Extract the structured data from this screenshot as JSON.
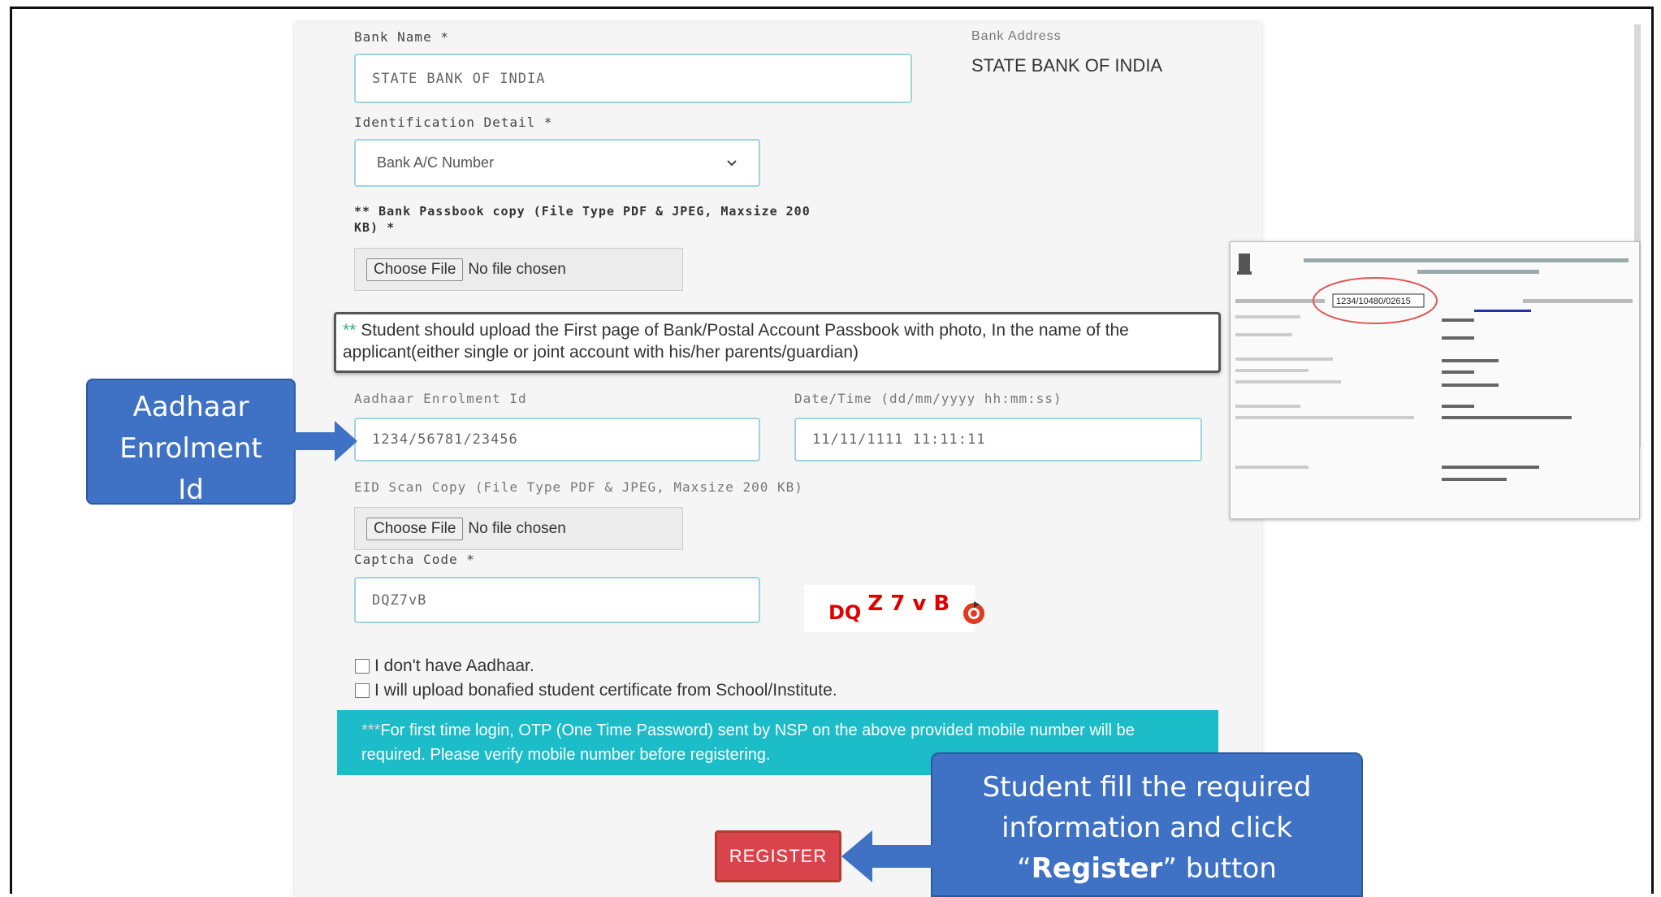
{
  "form": {
    "bank_name_label": "Bank Name *",
    "bank_name_value": "STATE BANK OF INDIA",
    "bank_address_label": "Bank Address",
    "bank_address_value": "STATE BANK OF INDIA",
    "identification_label": "Identification Detail *",
    "identification_value": "Bank A/C Number",
    "passbook_label": "** Bank Passbook copy (File Type PDF & JPEG, Maxsize 200 KB) *",
    "choose_file": "Choose File",
    "no_file": "No file chosen",
    "note_star": "**",
    "note_text": " Student should upload the First page of Bank/Postal Account Passbook with photo, In the name of the applicant(either single or joint account with his/her parents/guardian)",
    "aadhaar_label": "Aadhaar Enrolment Id",
    "aadhaar_value": "1234/56781/23456",
    "datetime_label": "Date/Time (dd/mm/yyyy hh:mm:ss)",
    "datetime_value": "11/11/1111 11:11:11",
    "eid_label": "EID Scan Copy (File Type PDF & JPEG, Maxsize 200 KB)",
    "captcha_label": "Captcha Code *",
    "captcha_value": "DQZ7vB",
    "captcha_image_text_a": "DQ",
    "captcha_image_text_b": "Z 7 v B",
    "no_aadhaar_label": "I don't have Aadhaar.",
    "bonafide_label": "I will upload bonafied student certificate from School/Institute.",
    "info_star": "***",
    "info_text": "For first time login, OTP (One Time Password) sent by NSP on the above provided mobile number will be required. Please verify mobile number before registering.",
    "register_label": "REGISTER"
  },
  "callouts": {
    "aadhaar_line1": "Aadhaar",
    "aadhaar_line2": "Enrolment",
    "aadhaar_line3": "Id",
    "register_line1": "Student fill the required",
    "register_line2": "information and click",
    "register_quote_open": "“",
    "register_bold": "Register",
    "register_quote_close": "” button"
  },
  "doc_image": {
    "enrolment_number": "1234/10480/02615"
  },
  "colors": {
    "callout_blue": "#3f72c4",
    "info_teal": "#1cbcc8",
    "register_red": "#d9434b"
  }
}
